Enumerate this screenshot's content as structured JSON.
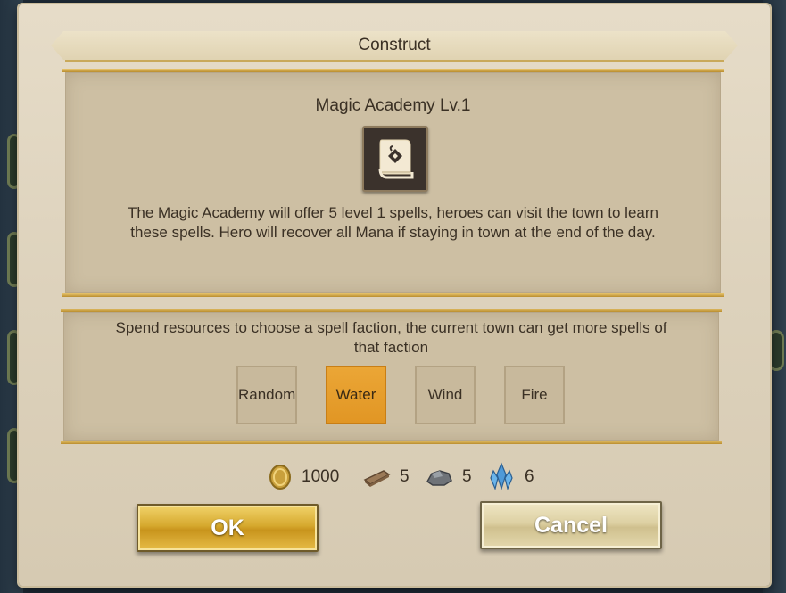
{
  "dialog": {
    "title": "Construct",
    "building_name": "Magic Academy Lv.1",
    "building_icon": "spell-book-icon",
    "description": "The Magic Academy will offer 5 level 1 spells, heroes can visit the town to learn these spells. Hero will recover all Mana if staying in town at the end of the day.",
    "faction_prompt": "Spend resources to choose a spell faction, the current town can get more spells of that faction",
    "factions": [
      {
        "label": "Random",
        "selected": false
      },
      {
        "label": "Water",
        "selected": true
      },
      {
        "label": "Wind",
        "selected": false
      },
      {
        "label": "Fire",
        "selected": false
      }
    ],
    "resources": [
      {
        "icon": "gold-coin-icon",
        "value": "1000"
      },
      {
        "icon": "wood-icon",
        "value": "5"
      },
      {
        "icon": "ore-icon",
        "value": "5"
      },
      {
        "icon": "crystal-icon",
        "value": "6"
      }
    ],
    "ok_label": "OK",
    "cancel_label": "Cancel"
  },
  "colors": {
    "selected_faction": "#e19624",
    "panel": "#cdbfa3",
    "gold_trim": "#c9a95a",
    "text": "#3a3024"
  }
}
